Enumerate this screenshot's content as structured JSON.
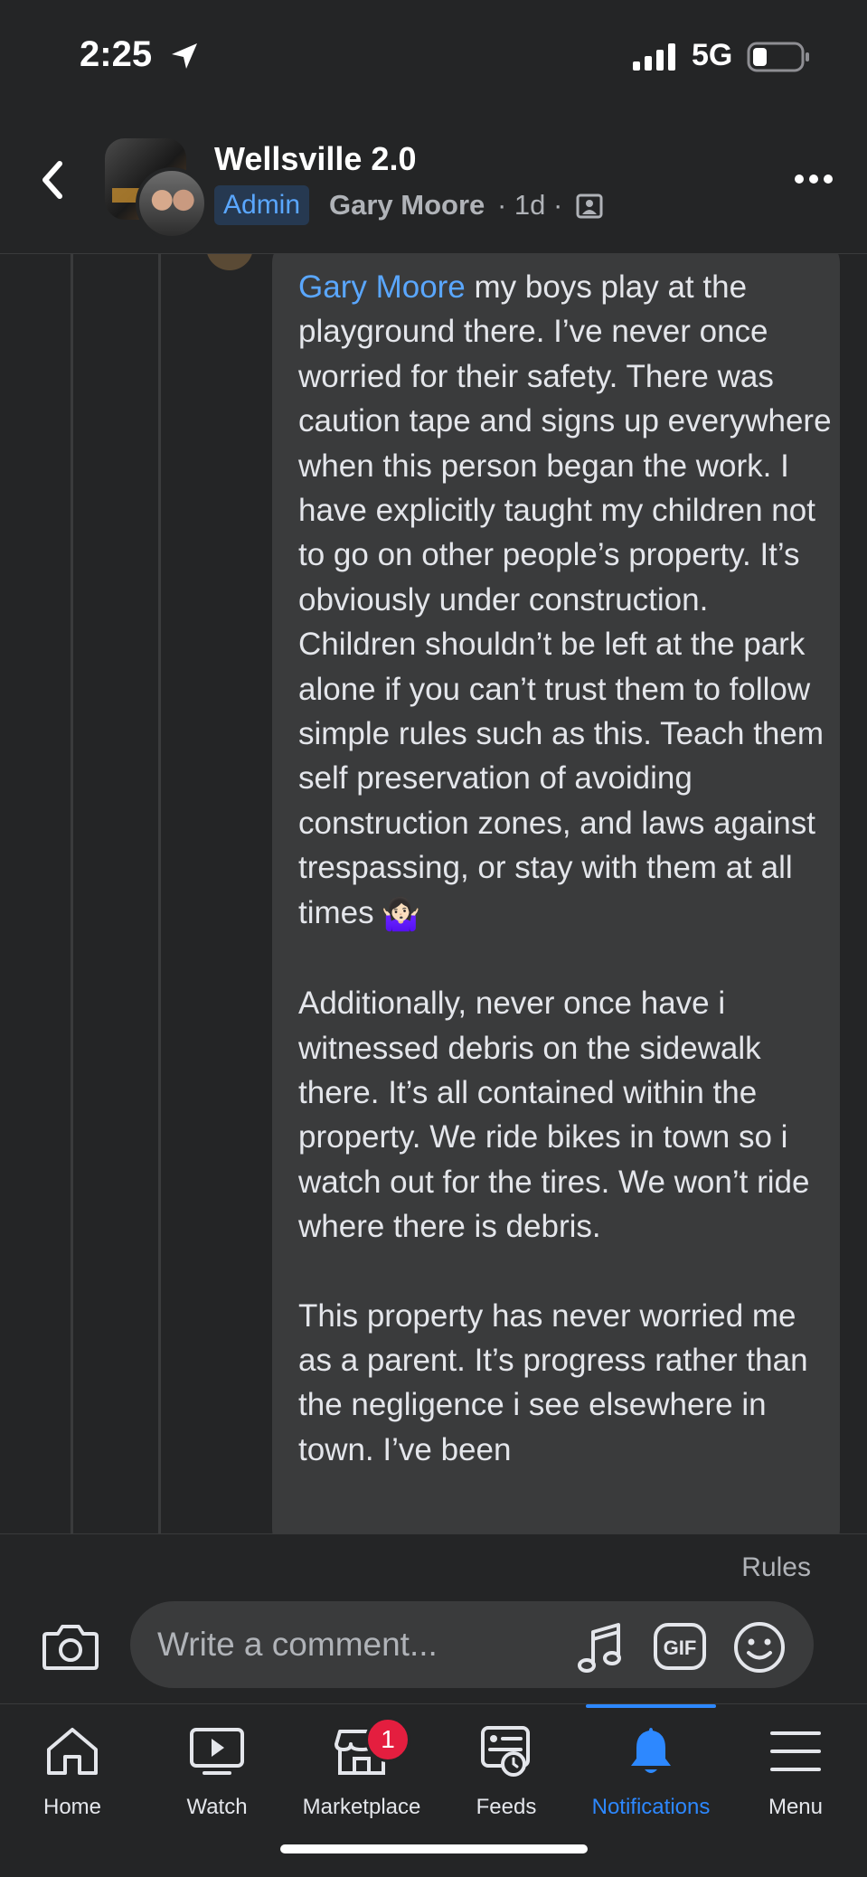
{
  "status_bar": {
    "time": "2:25",
    "network": "5G",
    "battery_level": 0.3
  },
  "header": {
    "group_name": "Wellsville 2.0",
    "role_badge": "Admin",
    "author": "Gary Moore",
    "meta": "· 1d ·"
  },
  "comment": {
    "mention": "Gary Moore",
    "paragraph1": " my boys play at the playground there. I’ve never once worried for their safety. There was caution tape and signs up everywhere when this person began the work. I have explicitly taught my children not to go on other people’s property. It’s obviously under construction. Children shouldn’t be left at the park alone if you can’t trust them to follow simple rules such as this. Teach them self preservation of avoiding construction zones, and laws against trespassing, or stay with them at all times",
    "emoji": "🤷🏻‍♀️",
    "paragraph2": "Additionally, never once have i witnessed debris on the sidewalk there. It’s all contained within the property. We ride bikes in town so i watch out for the tires. We won’t ride where there is debris.",
    "paragraph3": "This property has never worried me as a parent. It’s progress rather than the negligence i see elsewhere in town. I’ve been"
  },
  "composer": {
    "rules": "Rules",
    "placeholder": "Write a comment..."
  },
  "tabs": [
    {
      "label": "Home",
      "icon": "home-icon"
    },
    {
      "label": "Watch",
      "icon": "watch-icon"
    },
    {
      "label": "Marketplace",
      "icon": "marketplace-icon",
      "badge": "1"
    },
    {
      "label": "Feeds",
      "icon": "feeds-icon"
    },
    {
      "label": "Notifications",
      "icon": "bell-icon",
      "active": true
    },
    {
      "label": "Menu",
      "icon": "menu-icon"
    }
  ],
  "colors": {
    "accent": "#2d88ff",
    "mention": "#5aa7ff",
    "badge": "#e41e3f"
  }
}
